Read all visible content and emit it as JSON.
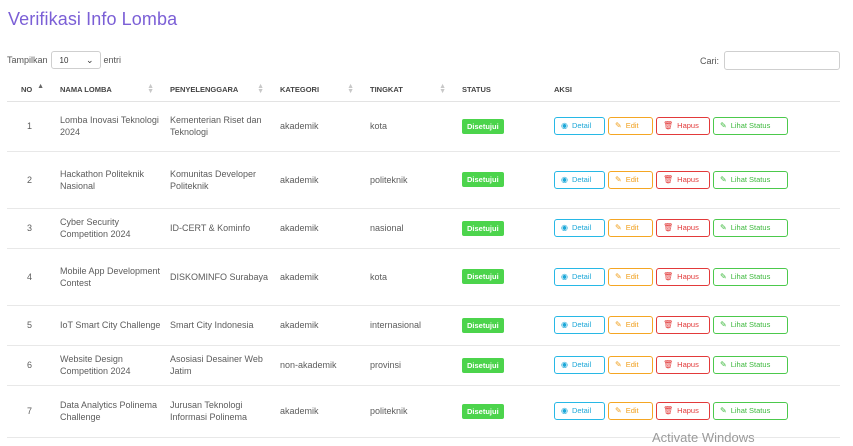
{
  "page": {
    "title": "Verifikasi Info Lomba"
  },
  "controls": {
    "show_label": "Tampilkan",
    "page_length": "10",
    "entries_label": "entri",
    "search_label": "Cari:",
    "search_value": ""
  },
  "table": {
    "columns": [
      "NO",
      "NAMA LOMBA",
      "PENYELENGGARA",
      "KATEGORI",
      "TINGKAT",
      "STATUS",
      "AKSI"
    ],
    "rows": [
      {
        "no": "1",
        "nama": "Lomba Inovasi Teknologi 2024",
        "penyelenggara": "Kementerian Riset dan Teknologi",
        "kategori": "akademik",
        "tingkat": "kota",
        "status": "Disetujui"
      },
      {
        "no": "2",
        "nama": "Hackathon Politeknik Nasional",
        "penyelenggara": "Komunitas Developer Politeknik",
        "kategori": "akademik",
        "tingkat": "politeknik",
        "status": "Disetujui"
      },
      {
        "no": "3",
        "nama": "Cyber Security Competition 2024",
        "penyelenggara": "ID-CERT & Kominfo",
        "kategori": "akademik",
        "tingkat": "nasional",
        "status": "Disetujui"
      },
      {
        "no": "4",
        "nama": "Mobile App Development Contest",
        "penyelenggara": "DISKOMINFO Surabaya",
        "kategori": "akademik",
        "tingkat": "kota",
        "status": "Disetujui"
      },
      {
        "no": "5",
        "nama": "IoT Smart City Challenge",
        "penyelenggara": "Smart City Indonesia",
        "kategori": "akademik",
        "tingkat": "internasional",
        "status": "Disetujui"
      },
      {
        "no": "6",
        "nama": "Website Design Competition 2024",
        "penyelenggara": "Asosiasi Desainer Web Jatim",
        "kategori": "non-akademik",
        "tingkat": "provinsi",
        "status": "Disetujui"
      },
      {
        "no": "7",
        "nama": "Data Analytics Polinema Challenge",
        "penyelenggara": "Jurusan Teknologi Informasi Polinema",
        "kategori": "akademik",
        "tingkat": "politeknik",
        "status": "Disetujui"
      }
    ]
  },
  "actions": {
    "detail": "Detail",
    "edit": "Edit",
    "hapus": "Hapus",
    "lihat_status": "Lihat Status"
  },
  "colors": {
    "title": "#7b5fd6",
    "status_badge": "#4cd44c",
    "detail": "#27b8e6",
    "edit": "#f5a623",
    "hapus": "#e23a3a",
    "lihat_status": "#4cc94c"
  },
  "icons": {
    "detail": "eye-icon",
    "edit": "edit-icon",
    "hapus": "trash-icon",
    "lihat_status": "edit-icon"
  },
  "watermark": "Activate Windows"
}
